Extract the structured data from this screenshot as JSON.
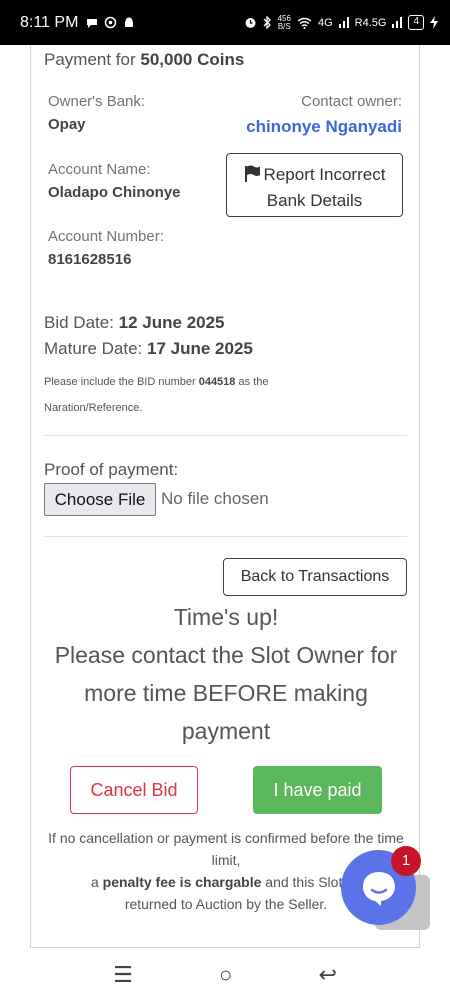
{
  "status_bar": {
    "time": "8:11 PM",
    "speed_top": "456",
    "speed_bottom": "B/S",
    "network1": "4G",
    "network2": "R4.5G",
    "battery": "4"
  },
  "payment": {
    "title_prefix": "Payment for ",
    "title_amount": "50,000 Coins"
  },
  "bank": {
    "owners_bank_label": "Owner's Bank:",
    "owners_bank_value": "Opay",
    "contact_owner_label": "Contact owner:",
    "contact_owner_value": "chinonye Nganyadi",
    "account_name_label": "Account Name:",
    "account_name_value": "Oladapo Chinonye",
    "account_number_label": "Account Number:",
    "account_number_value": "8161628516",
    "report_button": "Report Incorrect Bank Details"
  },
  "dates": {
    "bid_label": "Bid Date: ",
    "bid_value": "12 June 2025",
    "mature_label": "Mature Date: ",
    "mature_value": "17 June 2025",
    "note_prefix": "Please include the BID number ",
    "note_bid": "044518",
    "note_suffix": " as the Naration/Reference."
  },
  "proof": {
    "label": "Proof of payment:",
    "choose_file": "Choose File",
    "file_status": "No file chosen"
  },
  "actions": {
    "back_button": "Back to Transactions",
    "times_up": "Time's up!",
    "message": "Please contact the Slot Owner for more time BEFORE making payment",
    "cancel_button": "Cancel Bid",
    "paid_button": "I have paid"
  },
  "disclaimer": {
    "line1": "If no cancellation or payment is confirmed before the time limit,",
    "line2_prefix": "a ",
    "line2_bold": "penalty fee is chargable",
    "line2_suffix": " and this Slot co",
    "line3": "returned to Auction by the Seller."
  },
  "chat": {
    "badge_count": "1"
  },
  "nav": {
    "menu_glyph": "☰",
    "home_glyph": "○",
    "back_glyph": "↩"
  },
  "colors": {
    "link": "#3d68d8",
    "danger": "#dc3545",
    "success": "#5cb85c",
    "chat": "#5a73e8"
  }
}
